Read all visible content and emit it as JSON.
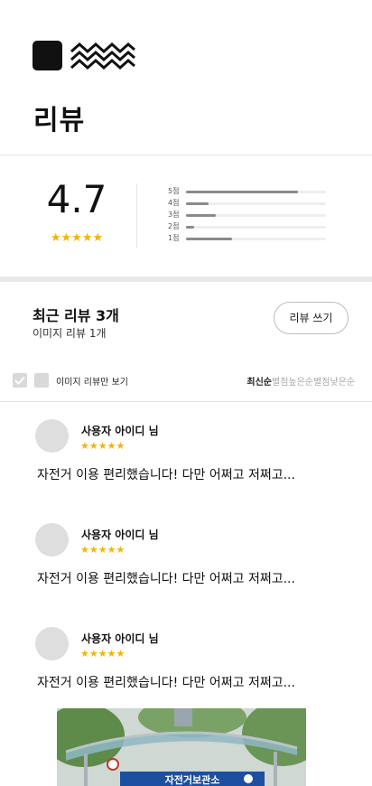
{
  "header": {
    "logo": "brand-logo",
    "title": "리뷰"
  },
  "summary": {
    "average": "4.7",
    "stars": "★★★★★",
    "distribution": [
      {
        "label": "5점",
        "fraction": 0.8
      },
      {
        "label": "4점",
        "fraction": 0.16
      },
      {
        "label": "3점",
        "fraction": 0.21
      },
      {
        "label": "2점",
        "fraction": 0.06
      },
      {
        "label": "1점",
        "fraction": 0.33
      }
    ]
  },
  "recent": {
    "title": "최근 리뷰 3개",
    "subtitle": "이미지 리뷰 1개",
    "write_button": "리뷰 쓰기"
  },
  "filter": {
    "image_only_label": "이미지 리뷰만 보기",
    "sort_options": [
      "최신순",
      "별점높은순",
      "별점낮은순"
    ],
    "active_sort": "최신순"
  },
  "reviews": [
    {
      "user": "사용자 아이디 님",
      "stars": "★★★★★",
      "text": "자전거 이용 편리했습니다! 다만 어쩌고 저쩌고..."
    },
    {
      "user": "사용자 아이디 님",
      "stars": "★★★★★",
      "text": "자전거 이용 편리했습니다! 다만 어쩌고 저쩌고..."
    },
    {
      "user": "사용자 아이디 님",
      "stars": "★★★★★",
      "text": "자전거 이용 편리했습니다! 다만 어쩌고 저쩌고..."
    }
  ],
  "photo": {
    "sign_text": "자전거보관소"
  },
  "colors": {
    "star": "#f5b400",
    "bar": "#8a8a8a",
    "divider": "#e6e6e6"
  }
}
